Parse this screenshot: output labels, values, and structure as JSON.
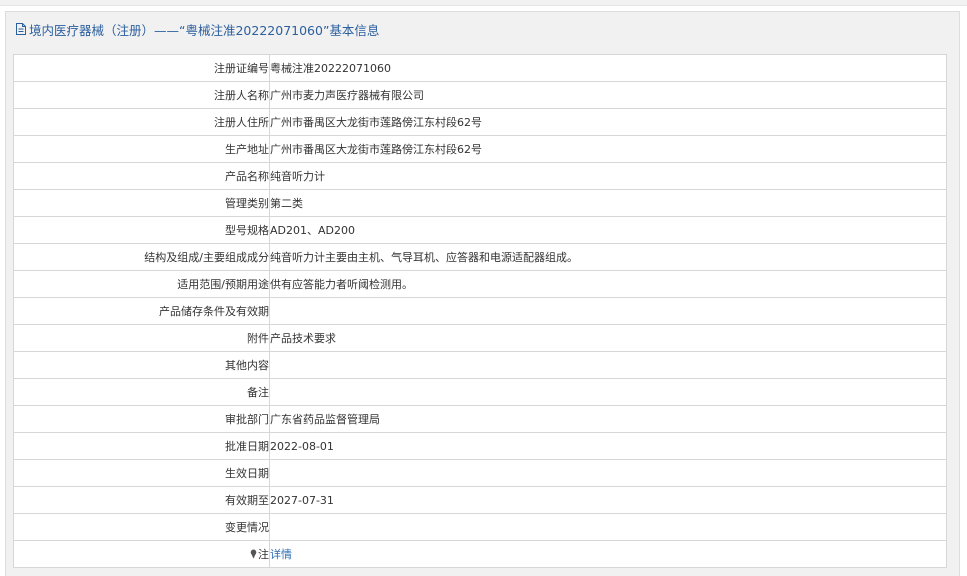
{
  "header": {
    "icon": "document-icon",
    "title": "境内医疗器械（注册）——“粤械注准20222071060”基本信息"
  },
  "rows": [
    {
      "label": "注册证编号",
      "value": "粤械注准20222071060"
    },
    {
      "label": "注册人名称",
      "value": "广州市麦力声医疗器械有限公司"
    },
    {
      "label": "注册人住所",
      "value": "广州市番禺区大龙街市莲路傍江东村段62号"
    },
    {
      "label": "生产地址",
      "value": "广州市番禺区大龙街市莲路傍江东村段62号"
    },
    {
      "label": "产品名称",
      "value": "纯音听力计"
    },
    {
      "label": "管理类别",
      "value": "第二类"
    },
    {
      "label": "型号规格",
      "value": "AD201、AD200"
    },
    {
      "label": "结构及组成/主要组成成分",
      "value": "纯音听力计主要由主机、气导耳机、应答器和电源适配器组成。"
    },
    {
      "label": "适用范围/预期用途",
      "value": "供有应答能力者听阈检测用。"
    },
    {
      "label": "产品储存条件及有效期",
      "value": ""
    },
    {
      "label": "附件",
      "value": "产品技术要求"
    },
    {
      "label": "其他内容",
      "value": ""
    },
    {
      "label": "备注",
      "value": ""
    },
    {
      "label": "审批部门",
      "value": "广东省药品监督管理局"
    },
    {
      "label": "批准日期",
      "value": "2022-08-01"
    },
    {
      "label": "生效日期",
      "value": ""
    },
    {
      "label": "有效期至",
      "value": "2027-07-31"
    },
    {
      "label": "变更情况",
      "value": ""
    }
  ],
  "note": {
    "icon": "pin-icon",
    "label": "注",
    "link_text": "详情"
  }
}
